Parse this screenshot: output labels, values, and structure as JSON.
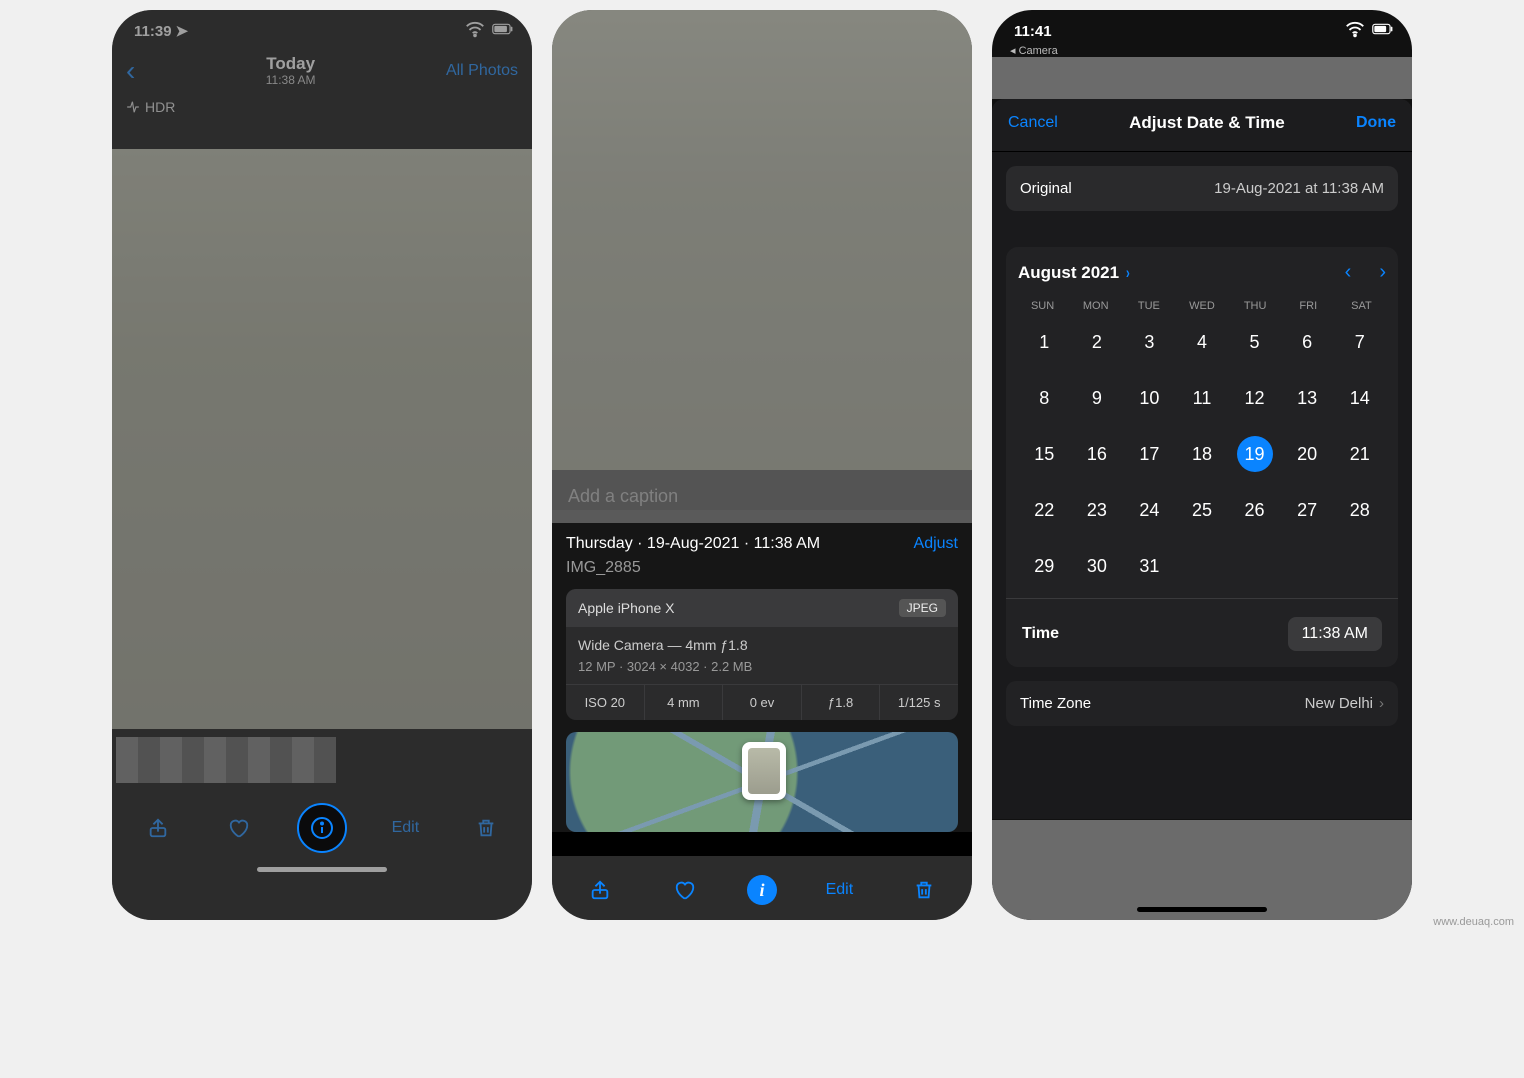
{
  "screen1": {
    "status_time": "11:39",
    "nav_title": "Today",
    "nav_subtitle": "11:38 AM",
    "all_photos": "All Photos",
    "hdr_label": "HDR",
    "edit_label": "Edit"
  },
  "screen2": {
    "caption_placeholder": "Add a caption",
    "date_line": "Thursday · 19-Aug-2021 · 11:38 AM",
    "adjust_label": "Adjust",
    "filename": "IMG_2885",
    "device": "Apple iPhone X",
    "format_badge": "JPEG",
    "lens_line": "Wide Camera — 4mm ƒ1.8",
    "specs_line": "12 MP  ·  3024 × 4032  ·  2.2 MB",
    "exif": {
      "iso": "ISO 20",
      "focal": "4 mm",
      "ev": "0 ev",
      "aperture": "ƒ1.8",
      "shutter": "1/125 s"
    },
    "edit_label": "Edit"
  },
  "screen3": {
    "status_time": "11:41",
    "source_app": "Camera",
    "cancel": "Cancel",
    "title": "Adjust Date & Time",
    "done": "Done",
    "original_label": "Original",
    "original_value": "19-Aug-2021 at 11:38 AM",
    "month_label": "August 2021",
    "dow": [
      "SUN",
      "MON",
      "TUE",
      "WED",
      "THU",
      "FRI",
      "SAT"
    ],
    "days": [
      "1",
      "2",
      "3",
      "4",
      "5",
      "6",
      "7",
      "8",
      "9",
      "10",
      "11",
      "12",
      "13",
      "14",
      "15",
      "16",
      "17",
      "18",
      "19",
      "20",
      "21",
      "22",
      "23",
      "24",
      "25",
      "26",
      "27",
      "28",
      "29",
      "30",
      "31"
    ],
    "selected_day": "19",
    "time_label": "Time",
    "time_value": "11:38 AM",
    "tz_label": "Time Zone",
    "tz_value": "New Delhi"
  },
  "watermark": "www.deuaq.com"
}
